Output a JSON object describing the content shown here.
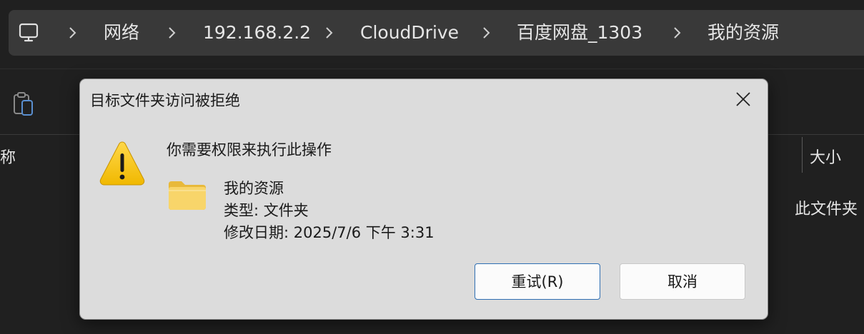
{
  "breadcrumb": {
    "icon": "computer-icon",
    "items": [
      "网络",
      "192.168.2.2",
      "CloudDrive",
      "百度网盘_1303",
      "我的资源"
    ]
  },
  "toolbar": {
    "paste_icon": "clipboard-icon"
  },
  "file_list": {
    "column_name": "称",
    "column_size": "大小",
    "row_type": "此文件夹"
  },
  "dialog": {
    "title": "目标文件夹访问被拒绝",
    "message": "你需要权限来执行此操作",
    "icon": "warning-icon",
    "folder_icon": "folder-icon",
    "item_name": "我的资源",
    "item_type": "类型: 文件夹",
    "item_modified": "修改日期: 2025/7/6 下午 3:31",
    "retry_label": "重试(R)",
    "cancel_label": "取消"
  },
  "colors": {
    "background": "#202020",
    "address_bar": "#393939",
    "dialog_bg": "#dcdcdc",
    "primary_button_border": "#2f6fb3",
    "warning_yellow": "#f5c400",
    "folder_yellow": "#f8d56a"
  }
}
